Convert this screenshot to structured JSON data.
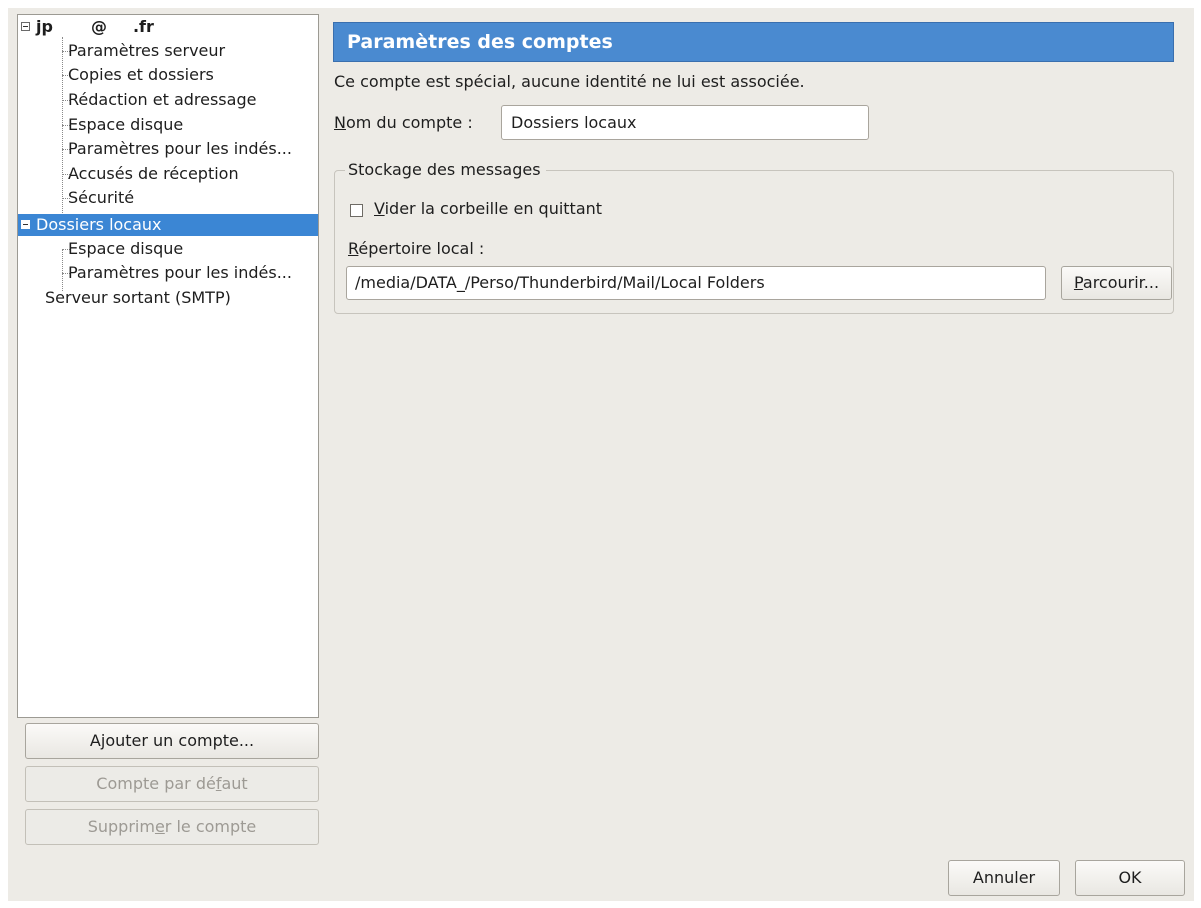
{
  "tree": {
    "account": {
      "user": "jp",
      "at": "@",
      "domain": ".fr"
    },
    "account_children": [
      "Paramètres serveur",
      "Copies et dossiers",
      "Rédaction et adressage",
      "Espace disque",
      "Paramètres pour les indés...",
      "Accusés de réception",
      "Sécurité"
    ],
    "local_folders": "Dossiers locaux",
    "local_children": [
      "Espace disque",
      "Paramètres pour les indés..."
    ],
    "smtp": "Serveur sortant (SMTP)"
  },
  "left_buttons": {
    "add_account": {
      "pre": "A",
      "key": "j",
      "post": "outer un compte..."
    },
    "default_account": {
      "pre": "Compte par dé",
      "key": "f",
      "post": "aut"
    },
    "delete_account": {
      "pre": "Supprim",
      "key": "e",
      "post": "r le compte"
    }
  },
  "panel": {
    "title": "Paramètres des comptes",
    "note": "Ce compte est spécial, aucune identité ne lui est associée.",
    "account_name_label": {
      "key": "N",
      "post": "om du compte :"
    },
    "account_name_value": "Dossiers locaux",
    "storage": {
      "legend": "Stockage des messages",
      "empty_trash": {
        "key": "V",
        "post": "ider la corbeille en quittant",
        "checked": false
      },
      "local_dir_label": {
        "key": "R",
        "post": "épertoire local :"
      },
      "local_dir_value": "/media/DATA_/Perso/Thunderbird/Mail/Local Folders",
      "browse": {
        "key": "P",
        "post": "arcourir..."
      }
    }
  },
  "dialog_buttons": {
    "cancel": "Annuler",
    "ok": "OK"
  },
  "colors": {
    "selection": "#3b86d4",
    "header": "#4a8ad0",
    "window_bg": "#edebe6"
  }
}
